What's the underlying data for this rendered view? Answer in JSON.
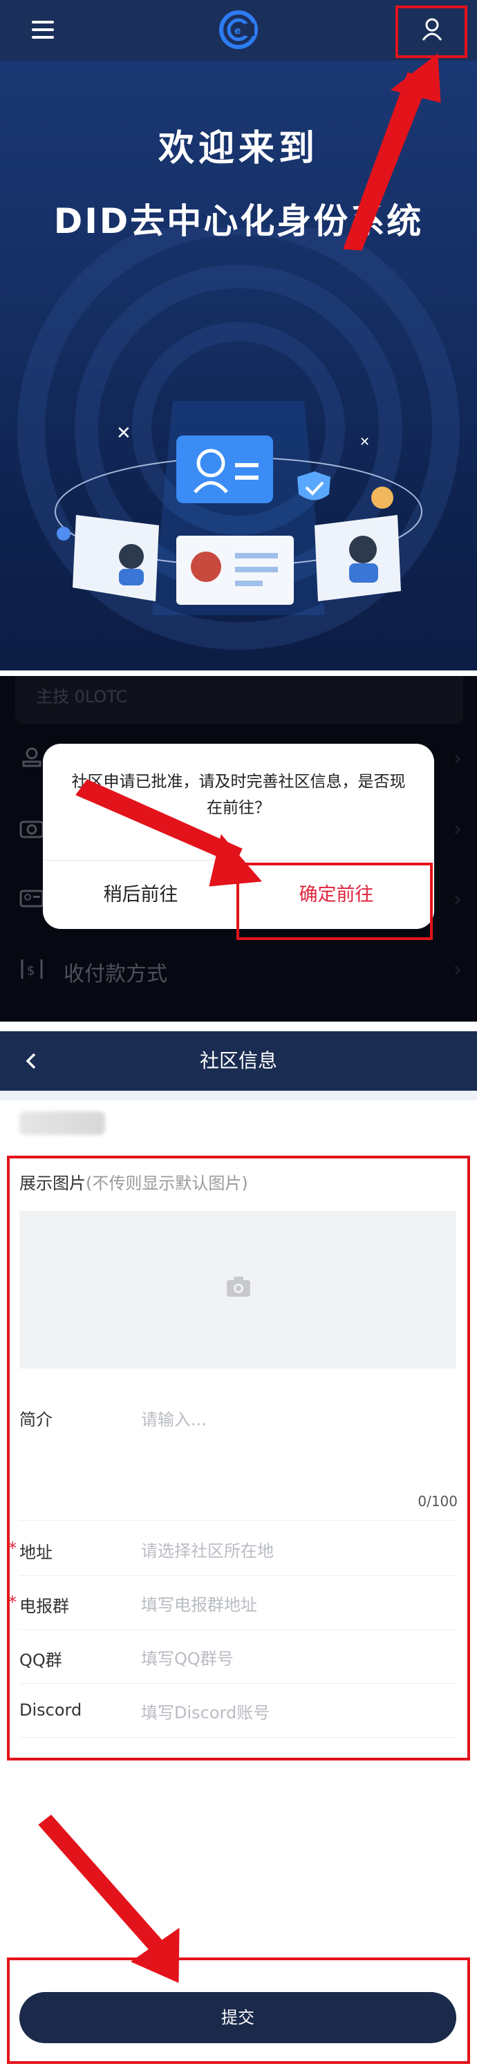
{
  "welcome": {
    "line1": "欢迎来到",
    "line2": "DID去中心化身份系统",
    "icons": [
      "menu-icon",
      "did-logo-icon",
      "user-icon"
    ]
  },
  "settings_bg": {
    "card_text": "主技   0LOTC",
    "payment_label": "收付款方式",
    "icons": [
      "stamp-icon",
      "camera-icon",
      "id-card-icon",
      "payment-icon",
      "chevron-right-icon"
    ]
  },
  "dialog": {
    "message": "社区申请已批准，请及时完善社区信息，是否现在前往？",
    "later_label": "稍后前往",
    "confirm_label": "确定前往"
  },
  "community_form": {
    "title": "社区信息",
    "photo_label": "展示图片",
    "photo_hint": "(不传则显示默认图片)",
    "intro_label": "简介",
    "intro_placeholder": "请输入...",
    "intro_count": "0/100",
    "address_label": "地址",
    "address_placeholder": "请选择社区所在地",
    "telegram_label": "电报群",
    "telegram_placeholder": "填写电报群地址",
    "qq_label": "QQ群",
    "qq_placeholder": "填写QQ群号",
    "discord_label": "Discord",
    "discord_placeholder": "填写Discord账号",
    "required_mark": "*",
    "submit_label": "提交"
  },
  "colors": {
    "header_navy": "#1b2f5b",
    "accent_red": "#e3131b",
    "confirm_red": "#e0243c",
    "submit_navy": "#1b2a4a"
  }
}
